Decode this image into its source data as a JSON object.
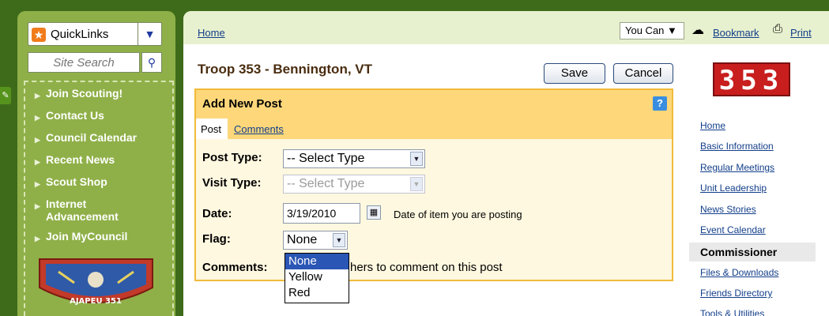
{
  "sidebar": {
    "quicklinks_label": "QuickLinks",
    "search_placeholder": "Site Search",
    "nav_items": [
      {
        "label": "Join Scouting!"
      },
      {
        "label": "Contact Us"
      },
      {
        "label": "Council Calendar"
      },
      {
        "label": "Recent News"
      },
      {
        "label": "Scout Shop"
      },
      {
        "label": "Internet Advancement"
      },
      {
        "label": "Join MyCouncil"
      }
    ],
    "patch_text": "AJAPEU 351"
  },
  "topbar": {
    "home": "Home",
    "you_can": "You Can ▼",
    "bookmark": "Bookmark",
    "print": "Print"
  },
  "main": {
    "title": "Troop 353 - Bennington, VT",
    "save": "Save",
    "cancel": "Cancel"
  },
  "panel": {
    "title": "Add New Post",
    "help": "?",
    "tab_post": "Post",
    "tab_comments": "Comments",
    "post_type_label": "Post Type:",
    "post_type_value": "-- Select Type",
    "visit_type_label": "Visit Type:",
    "visit_type_value": "-- Select Type",
    "date_label": "Date:",
    "date_value": "3/19/2010",
    "date_hint": "Date of item you are posting",
    "flag_label": "Flag:",
    "flag_value": "None",
    "comments_label": "Comments:",
    "comments_text": "hers to comment on this post",
    "flag_options": [
      "None",
      "Yellow",
      "Red"
    ]
  },
  "right": {
    "logo": "353",
    "links": [
      "Home",
      "Basic Information",
      "Regular Meetings",
      "Unit Leadership",
      "News Stories",
      "Event Calendar"
    ],
    "commissioner": "Commissioner",
    "links2": [
      "Files & Downloads",
      "Friends Directory",
      "Tools & Utilities"
    ]
  },
  "colors": {
    "sidebar_green": "#8fb048",
    "panel_orange": "#fdd77a",
    "logo_red": "#c81e1e",
    "link_blue": "#123e8a"
  }
}
